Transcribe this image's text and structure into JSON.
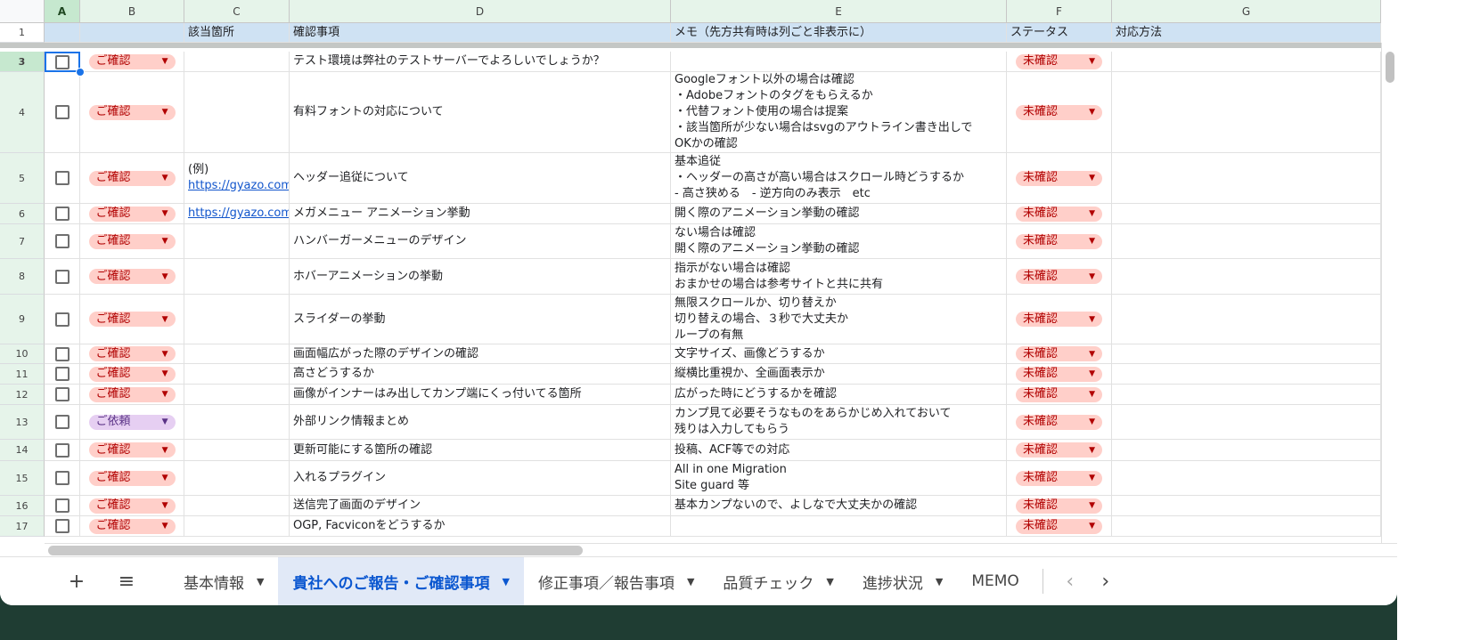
{
  "columns": [
    "A",
    "B",
    "C",
    "D",
    "E",
    "F",
    "G"
  ],
  "header_row": {
    "number": "1",
    "C": "該当箇所",
    "D": "確認事項",
    "E": "メモ（先方共有時は列ごと非表示に）",
    "F": "ステータス",
    "G": "対応方法"
  },
  "rows": [
    {
      "n": "3",
      "b": "ご確認",
      "c": "",
      "d": "テスト環境は弊社のテストサーバーでよろしいでしょうか？",
      "e": "",
      "f": "未確認"
    },
    {
      "n": "4",
      "b": "ご確認",
      "c": "",
      "d": "有料フォントの対応について",
      "e": "Googleフォント以外の場合は確認\n・Adobeフォントのタグをもらえるか\n・代替フォント使用の場合は提案\n・該当箇所が少ない場合はsvgのアウトライン書き出しで\nOKかの確認",
      "f": "未確認"
    },
    {
      "n": "5",
      "b": "ご確認",
      "c": "(例)",
      "c_link": "https://gyazo.com/",
      "d": "ヘッダー追従について",
      "e": "基本追従\n・ヘッダーの高さが高い場合はスクロール時どうするか\n- 高さ狭める　- 逆方向のみ表示　etc",
      "f": "未確認"
    },
    {
      "n": "6",
      "b": "ご確認",
      "c": "",
      "c_link": "https://gyazo.com/",
      "d": "メガメニュー アニメーション挙動",
      "e": "開く際のアニメーション挙動の確認",
      "f": "未確認"
    },
    {
      "n": "7",
      "b": "ご確認",
      "c": "",
      "d": "ハンバーガーメニューのデザイン",
      "e": "ない場合は確認\n開く際のアニメーション挙動の確認",
      "f": "未確認"
    },
    {
      "n": "8",
      "b": "ご確認",
      "c": "",
      "d": "ホバーアニメーションの挙動",
      "e": "指示がない場合は確認\nおまかせの場合は参考サイトと共に共有",
      "f": "未確認"
    },
    {
      "n": "9",
      "b": "ご確認",
      "c": "",
      "d": "スライダーの挙動",
      "e": "無限スクロールか、切り替えか\n切り替えの場合、３秒で大丈夫か\nループの有無",
      "f": "未確認"
    },
    {
      "n": "10",
      "b": "ご確認",
      "c": "",
      "d": "画面幅広がった際のデザインの確認",
      "e": "文字サイズ、画像どうするか",
      "f": "未確認"
    },
    {
      "n": "11",
      "b": "ご確認",
      "c": "",
      "d": "高さどうするか",
      "e": "縦横比重視か、全画面表示か",
      "f": "未確認"
    },
    {
      "n": "12",
      "b": "ご確認",
      "c": "",
      "d": "画像がインナーはみ出してカンプ端にくっ付いてる箇所",
      "e": "広がった時にどうするかを確認",
      "f": "未確認"
    },
    {
      "n": "13",
      "b": "ご依頼",
      "c": "",
      "d": "外部リンク情報まとめ",
      "e": "カンプ見て必要そうなものをあらかじめ入れておいて\n残りは入力してもらう",
      "f": "未確認"
    },
    {
      "n": "14",
      "b": "ご確認",
      "c": "",
      "d": "更新可能にする箇所の確認",
      "e": "投稿、ACF等での対応",
      "f": "未確認"
    },
    {
      "n": "15",
      "b": "ご確認",
      "c": "",
      "d": "入れるプラグイン",
      "e": "All in one Migration\nSite guard 等",
      "f": "未確認"
    },
    {
      "n": "16",
      "b": "ご確認",
      "c": "",
      "d": "送信完了画面のデザイン",
      "e": "基本カンプないので、よしなで大丈夫かの確認",
      "f": "未確認"
    },
    {
      "n": "17",
      "b": "ご確認",
      "c": "",
      "d": "OGP, Facviconをどうするか",
      "e": "",
      "f": "未確認"
    }
  ],
  "tabs": [
    {
      "label": "基本情報",
      "active": false
    },
    {
      "label": "貴社へのご報告・ご確認事項",
      "active": true
    },
    {
      "label": "修正事項／報告事項",
      "active": false
    },
    {
      "label": "品質チェック",
      "active": false
    },
    {
      "label": "進捗状況",
      "active": false
    },
    {
      "label": "MEMO",
      "active": false,
      "noarrow": true
    }
  ],
  "toolbar": {
    "add": "+",
    "menu": "≡",
    "prev": "‹",
    "next": "›",
    "dropdown": "▼"
  },
  "colors": {
    "chip_red": "#ffcfc9",
    "chip_purple": "#e6cff2",
    "accent": "#0b57d0"
  }
}
